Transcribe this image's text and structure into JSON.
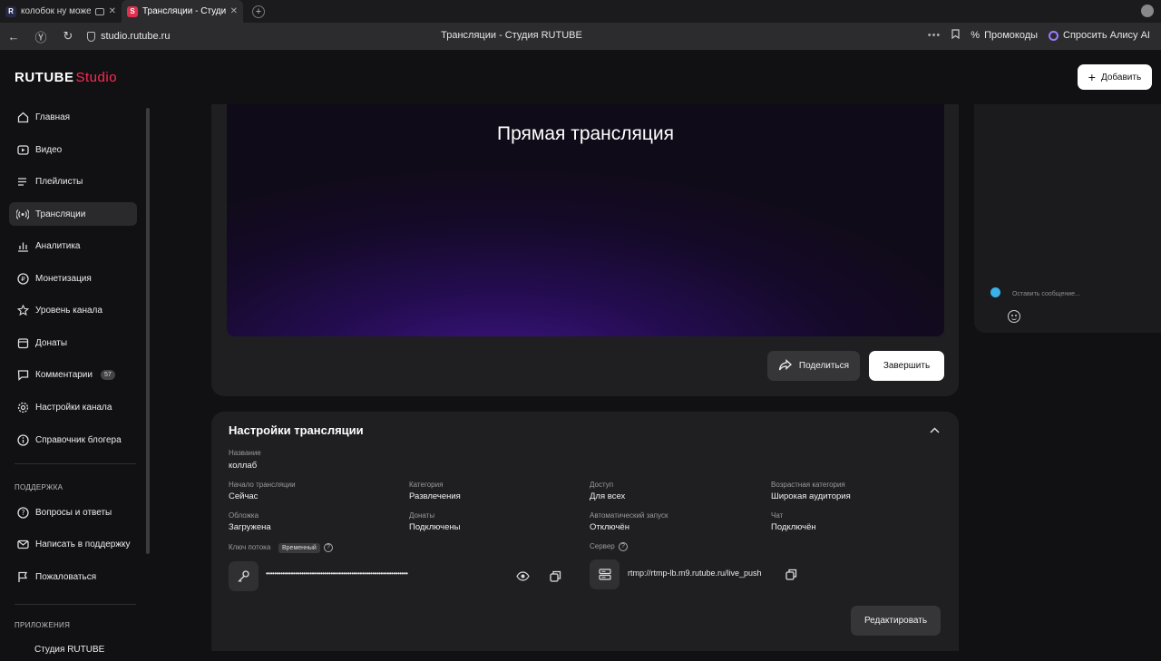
{
  "browser": {
    "tabs": [
      {
        "favicon": "R",
        "title": "колобок ну можете"
      },
      {
        "favicon": "S",
        "title": "Трансляции - Студия R"
      }
    ],
    "url": "studio.rutube.ru",
    "page_title": "Трансляции - Студия RUTUBE",
    "promo_label": "Промокоды",
    "alice_label": "Спросить Алису AI"
  },
  "app": {
    "logo_main": "RUTUBE",
    "logo_sub": "Studio",
    "add_label": "Добавить"
  },
  "sidebar": {
    "items": [
      {
        "label": "Главная",
        "icon": "home-icon"
      },
      {
        "label": "Видео",
        "icon": "video-icon"
      },
      {
        "label": "Плейлисты",
        "icon": "playlist-icon"
      },
      {
        "label": "Трансляции",
        "icon": "broadcast-icon",
        "active": true
      },
      {
        "label": "Аналитика",
        "icon": "analytics-icon"
      },
      {
        "label": "Монетизация",
        "icon": "monetization-icon"
      },
      {
        "label": "Уровень канала",
        "icon": "star-icon"
      },
      {
        "label": "Донаты",
        "icon": "donate-icon"
      },
      {
        "label": "Комментарии",
        "icon": "comments-icon",
        "badge": "57"
      },
      {
        "label": "Настройки канала",
        "icon": "gear-icon"
      },
      {
        "label": "Справочник блогера",
        "icon": "info-icon"
      }
    ],
    "support_title": "ПОДДЕРЖКА",
    "support_items": [
      {
        "label": "Вопросы и ответы",
        "icon": "help-icon"
      },
      {
        "label": "Написать в поддержку",
        "icon": "mail-icon"
      },
      {
        "label": "Пожаловаться",
        "icon": "flag-icon"
      }
    ],
    "apps_title": "ПРИЛОЖЕНИЯ",
    "apps_items": [
      {
        "label": "Студия RUTUBE"
      }
    ]
  },
  "player": {
    "title": "Прямая трансляция",
    "share_label": "Поделиться",
    "end_label": "Завершить"
  },
  "chat": {
    "placeholder": "Оставить сообщение..."
  },
  "settings": {
    "title": "Настройки трансляции",
    "name_label": "Название",
    "name_value": "коллаб",
    "fields": [
      {
        "label": "Начало трансляции",
        "value": "Сейчас"
      },
      {
        "label": "Категория",
        "value": "Развлечения"
      },
      {
        "label": "Доступ",
        "value": "Для всех"
      },
      {
        "label": "Возрастная категория",
        "value": "Широкая аудитория"
      },
      {
        "label": "Обложка",
        "value": "Загружена"
      },
      {
        "label": "Донаты",
        "value": "Подключены"
      },
      {
        "label": "Автоматический запуск",
        "value": "Отключён"
      },
      {
        "label": "Чат",
        "value": "Подключён"
      }
    ],
    "stream_key_label": "Ключ потока",
    "stream_key_tag": "Временный",
    "stream_key_value": "••••••••••••••••••••••••••••••••••••••••••••••••••••••••••••••••••••",
    "server_label": "Сервер",
    "server_value": "rtmp://rtmp-lb.m9.rutube.ru/live_push",
    "edit_label": "Редактировать"
  }
}
